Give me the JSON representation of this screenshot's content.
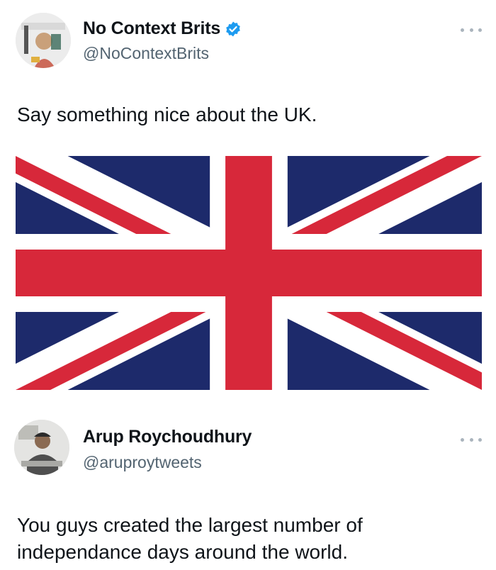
{
  "tweet": {
    "display_name": "No Context Brits",
    "verified": true,
    "handle": "@NoContextBrits",
    "text": "Say something nice about the UK.",
    "media": "union-jack-flag"
  },
  "reply": {
    "display_name": "Arup Roychoudhury",
    "handle": "@aruproytweets",
    "text_line_1": "You guys created the largest number of",
    "text_line_2": "independance days around the world."
  },
  "colors": {
    "flag_blue": "#1d2a6b",
    "flag_red": "#d7283a",
    "verified_blue": "#1d9bf0",
    "handle_gray": "#536471"
  },
  "icons": {
    "more": "more-options-icon",
    "verified": "verified-badge-icon"
  }
}
